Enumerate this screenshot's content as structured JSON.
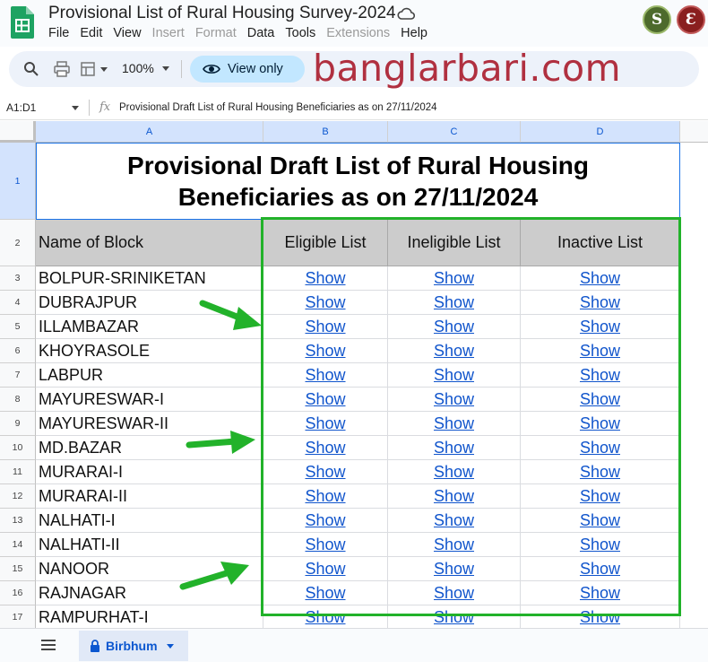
{
  "window": {
    "title": "Provisional List of Rural Housing Survey-2024",
    "avatars": [
      "S",
      "Ɛ"
    ]
  },
  "menu": [
    "File",
    "Edit",
    "View",
    "Insert",
    "Format",
    "Data",
    "Tools",
    "Extensions",
    "Help"
  ],
  "menu_disabled": [
    "Insert",
    "Format",
    "Extensions"
  ],
  "toolbar": {
    "zoom": "100%",
    "view_only_label": "View only"
  },
  "watermark": "banglarbari.com",
  "formula_bar": {
    "name_box": "A1:D1",
    "fx": "fx",
    "formula": "Provisional Draft List of Rural Housing Beneficiaries as on 27/11/2024"
  },
  "columns": [
    "A",
    "B",
    "C",
    "D"
  ],
  "row_numbers": [
    "1",
    "2",
    "3",
    "4",
    "5",
    "6",
    "7",
    "8",
    "9",
    "10",
    "11",
    "12",
    "13",
    "14",
    "15",
    "16",
    "17"
  ],
  "sheet": {
    "title_line1": "Provisional Draft List of Rural Housing",
    "title_line2": "Beneficiaries as on 27/11/2024",
    "headers": [
      "Name of Block",
      "Eligible List",
      "Ineligible List",
      "Inactive List"
    ],
    "link_label": "Show",
    "blocks": [
      "BOLPUR-SRINIKETAN",
      "DUBRAJPUR",
      "ILLAMBAZAR",
      "KHOYRASOLE",
      "LABPUR",
      "MAYURESWAR-I",
      "MAYURESWAR-II",
      "MD.BAZAR",
      "MURARAI-I",
      "MURARAI-II",
      "NALHATI-I",
      "NALHATI-II",
      "NANOOR",
      "RAJNAGAR",
      "RAMPURHAT-I"
    ]
  },
  "sheet_tab": {
    "name": "Birbhum"
  },
  "colors": {
    "highlight_box": "#22b22a",
    "link": "#1155cc",
    "header_fill": "#cccccc",
    "watermark": "#b03040"
  }
}
